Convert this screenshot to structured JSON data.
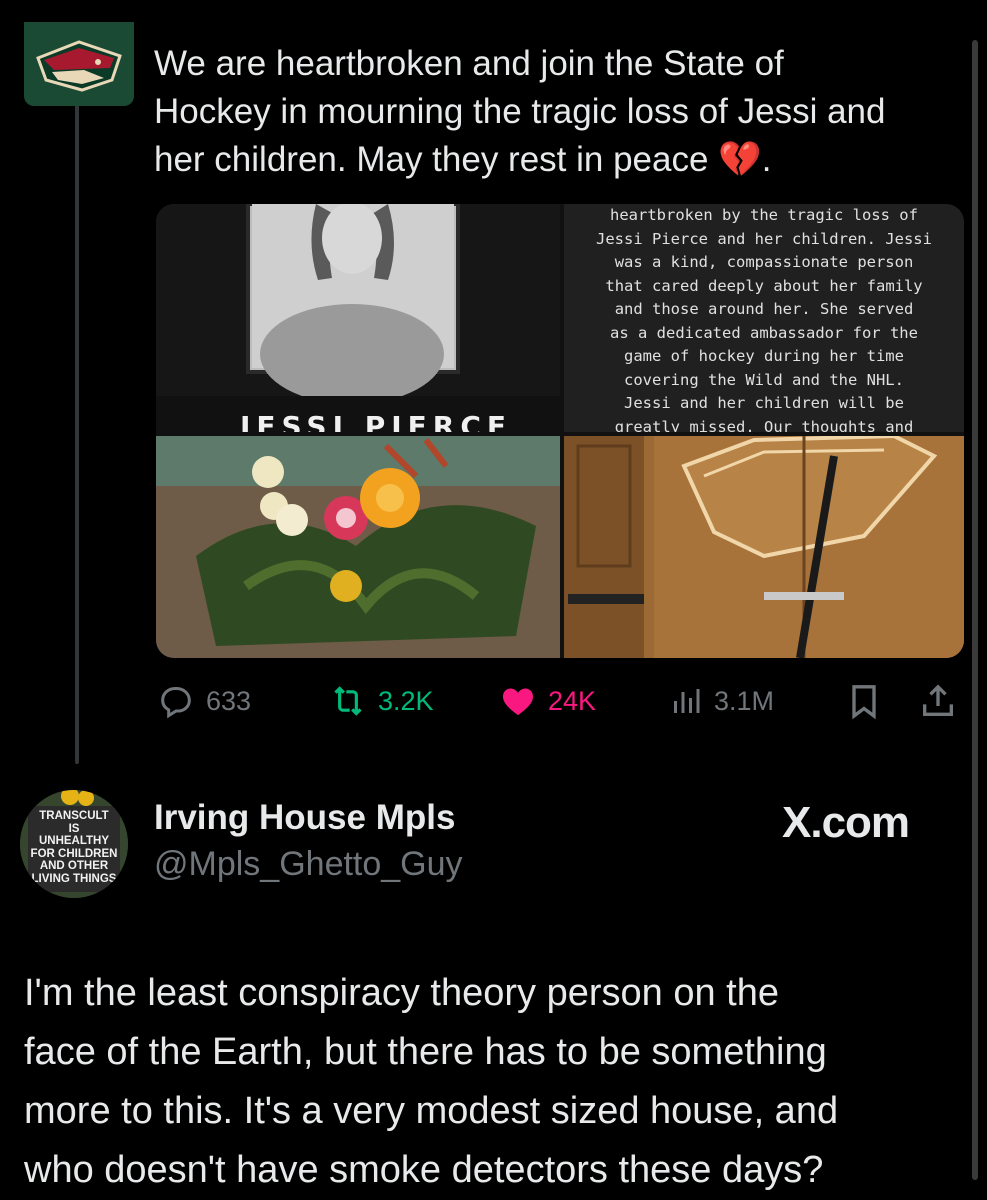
{
  "tweet": {
    "text": "We are heartbroken and join the State of\nHockey in mourning the tragic loss of Jessi and\nher children. May they rest in peace 💔.",
    "media": {
      "portrait_caption": "JESSI PIERCE",
      "statement_text": "heartbroken by the tragic loss of\nJessi Pierce and her children. Jessi\nwas a kind, compassionate person\nthat cared deeply about her family\nand those around her. She served\nas a dedicated ambassador for the\ngame of hockey during her time\ncovering the Wild and the NHL.\nJessi and her children will be\ngreatly missed. Our thoughts and"
    },
    "metrics": {
      "replies": "633",
      "reposts": "3.2K",
      "likes": "24K",
      "views": "3.1M"
    },
    "colors": {
      "repost": "#00ba7c",
      "like": "#f91880",
      "muted": "#71767b"
    }
  },
  "reply": {
    "display_name": "Irving House Mpls",
    "handle": "@Mpls_Ghetto_Guy",
    "avatar_sign": "TRANSCULT\nIS\nUNHEALTHY\nFOR CHILDREN\nAND OTHER\nLIVING THINGS",
    "text": "I'm the least conspiracy theory person on the\nface of the Earth, but there has to be something\nmore to this. It's a very modest sized house, and\nwho doesn't have smoke detectors these days?"
  },
  "brand": "X.com"
}
